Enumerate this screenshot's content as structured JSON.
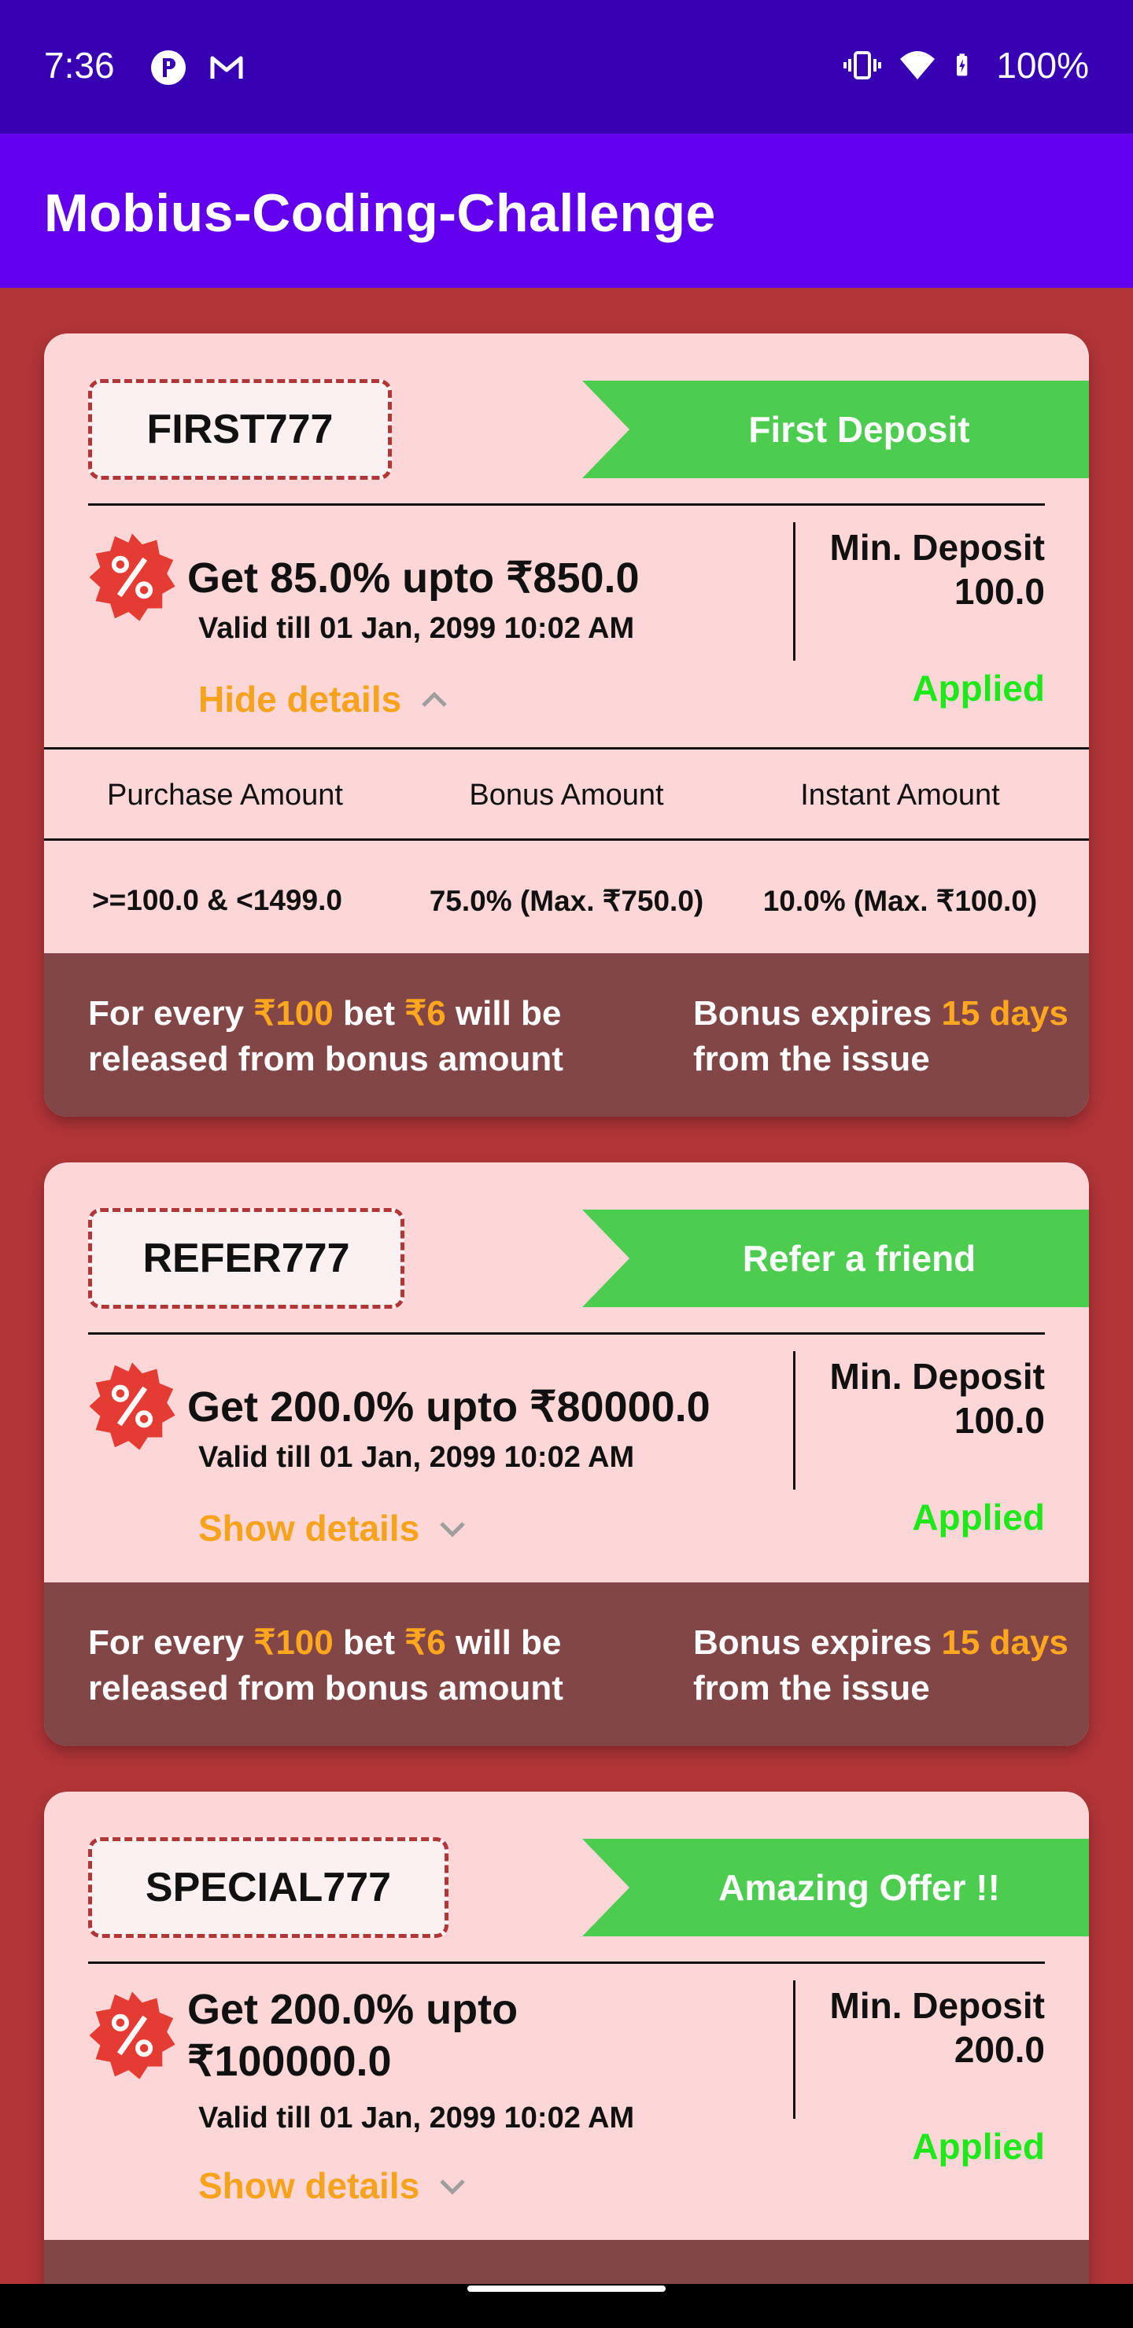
{
  "status_bar": {
    "time": "7:36",
    "battery": "100%",
    "icons": [
      "circle-p-icon",
      "gmail-icon",
      "vibrate-icon",
      "wifi-icon",
      "battery-charging-icon"
    ]
  },
  "app_bar": {
    "title": "Mobius-Coding-Challenge"
  },
  "colors": {
    "background": "#b23538",
    "card": "#fdd7d7",
    "ribbon": "#4ccd4f",
    "accent_orange": "#ffa81f",
    "applied_green": "#1ee81a",
    "info_bar": "#834646"
  },
  "cards": [
    {
      "code": "FIRST777",
      "ribbon": "First Deposit",
      "offer": "Get 85.0% upto ₹850.0",
      "valid": "Valid till 01 Jan, 2099 10:02 AM",
      "toggle": "Hide details",
      "min_deposit_label": "Min. Deposit",
      "min_deposit_value": "100.0",
      "status": "Applied",
      "table": {
        "headers": [
          "Purchase Amount",
          "Bonus Amount",
          "Instant Amount"
        ],
        "rows": [
          [
            ">=100.0 & <1499.0",
            "75.0% (Max. ₹750.0)",
            "10.0% (Max. ₹100.0)"
          ]
        ]
      },
      "info_left": {
        "p1": "For every ",
        "amount": "₹100",
        "p2": " bet ",
        "bet": "₹6",
        "p3": " will be released from bonus amount"
      },
      "info_right": {
        "p1": "Bonus expires ",
        "days": "15 days",
        "p2": " from the issue"
      }
    },
    {
      "code": "REFER777",
      "ribbon": "Refer a friend",
      "offer": "Get 200.0% upto ₹80000.0",
      "valid": "Valid till 01 Jan, 2099 10:02 AM",
      "toggle": "Show details",
      "min_deposit_label": "Min. Deposit",
      "min_deposit_value": "100.0",
      "status": "Applied",
      "info_left": {
        "p1": "For every ",
        "amount": "₹100",
        "p2": " bet ",
        "bet": "₹6",
        "p3": " will be released from bonus amount"
      },
      "info_right": {
        "p1": "Bonus expires ",
        "days": "15 days",
        "p2": " from the issue"
      }
    },
    {
      "code": "SPECIAL777",
      "ribbon": "Amazing Offer !!",
      "offer_line1": "Get 200.0% upto",
      "offer_line2": "₹100000.0",
      "valid": "Valid till 01 Jan, 2099 10:02 AM",
      "toggle": "Show details",
      "min_deposit_label": "Min. Deposit",
      "min_deposit_value": "200.0",
      "status": "Applied"
    }
  ]
}
